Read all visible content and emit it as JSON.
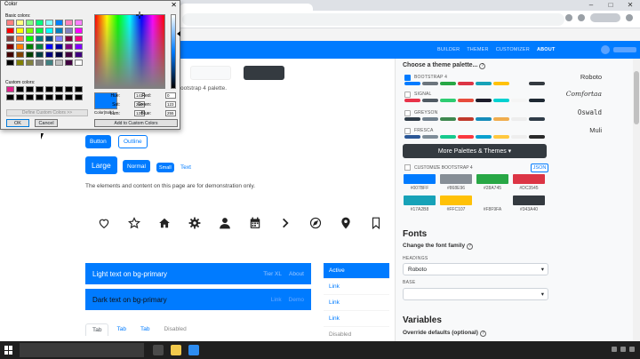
{
  "window_controls": [
    "–",
    "□",
    "✕"
  ],
  "navbar": {
    "links": [
      "BUILDER",
      "THEMER",
      "CUSTOMIZER",
      "ABOUT"
    ],
    "active": "ABOUT"
  },
  "page": {
    "palette_note": "ootstrap 4 palette.",
    "buttons": {
      "button": "Button",
      "outline": "Outline",
      "large": "Large",
      "normal": "Normal",
      "small": "Small",
      "text": "Text"
    },
    "demo_text": "The elements and content on this page are for demonstration only.",
    "icons": [
      "heart-icon",
      "star-icon",
      "home-icon",
      "gear-icon",
      "user-icon",
      "calendar-icon",
      "chevron-right-icon",
      "compass-icon",
      "map-pin-icon",
      "bookmark-icon"
    ],
    "alert_light": {
      "text": "Light text on bg-primary",
      "links": [
        "Tier XL",
        "About"
      ]
    },
    "alert_dark": {
      "text": "Dark text on bg-primary",
      "links": [
        "Link",
        "Demo"
      ]
    },
    "list_group": [
      "Active",
      "Link",
      "Link",
      "Link",
      "Disabled"
    ],
    "tabs": [
      "Tab",
      "Tab",
      "Tab",
      "Disabled"
    ]
  },
  "side": {
    "choose_title": "Choose a theme palette...",
    "themes": [
      {
        "name": "BOOTSTRAP 4",
        "checked": true,
        "font": "Roboto",
        "colors": [
          "#007bff",
          "#6c757d",
          "#28a745",
          "#dc3545",
          "#17a2b8",
          "#ffc107",
          "#f8f9fa",
          "#343a40"
        ]
      },
      {
        "name": "SIGNAL",
        "checked": false,
        "font": "Comfortaa",
        "colors": [
          "#e8334a",
          "#505a63",
          "#2ecc71",
          "#e74c3c",
          "#1c1c2b",
          "#00d1d1",
          "#f5f5f5",
          "#1f2933"
        ]
      },
      {
        "name": "GREYSON",
        "checked": false,
        "font": "Oswald",
        "colors": [
          "#2f3c48",
          "#6f7f8c",
          "#3e884f",
          "#c0392b",
          "#158cba",
          "#f0ad4e",
          "#ededed",
          "#2f3c48"
        ]
      },
      {
        "name": "FRESCA",
        "checked": false,
        "font": "Muli",
        "colors": [
          "#2b5797",
          "#7d8c98",
          "#16c98d",
          "#fa383e",
          "#0aa1cf",
          "#ffc83f",
          "#eeeeee",
          "#2a2a2a"
        ]
      }
    ],
    "more_button": "More Palettes & Themes",
    "customize_label": "CUSTOMIZE BOOTSTRAP 4",
    "json_button": "JSON",
    "swatches": [
      {
        "hex": "#007BFF",
        "color": "#007bff"
      },
      {
        "hex": "#868E96",
        "color": "#868e96"
      },
      {
        "hex": "#28A745",
        "color": "#28a745"
      },
      {
        "hex": "#DC3545",
        "color": "#dc3545"
      },
      {
        "hex": "#17A2B8",
        "color": "#17a2b8"
      },
      {
        "hex": "#FFC107",
        "color": "#ffc107"
      },
      {
        "hex": "#F8F9FA",
        "color": "#f8f9fa"
      },
      {
        "hex": "#343A40",
        "color": "#343a40"
      }
    ],
    "fonts_title": "Fonts",
    "fonts_sub": "Change the font family",
    "headings_label": "HEADINGS",
    "headings_value": "Roboto",
    "base_label": "BASE",
    "base_value": "",
    "variables_title": "Variables",
    "variables_sub": "Override defaults (optional)"
  },
  "dialog": {
    "title": "Color",
    "close": "✕",
    "basic_label": "Basic colors:",
    "basic_colors": [
      "#ff8080",
      "#ffff80",
      "#80ff80",
      "#00ff80",
      "#80ffff",
      "#0080ff",
      "#ff80c0",
      "#ff80ff",
      "#ff0000",
      "#ffff00",
      "#80ff00",
      "#00ff40",
      "#00ffff",
      "#0080c0",
      "#8080c0",
      "#ff00ff",
      "#804040",
      "#ff8040",
      "#00ff00",
      "#008080",
      "#004080",
      "#8080ff",
      "#800040",
      "#ff0080",
      "#800000",
      "#ff8000",
      "#008000",
      "#008040",
      "#0000ff",
      "#0000a0",
      "#800080",
      "#8000ff",
      "#400000",
      "#804000",
      "#004000",
      "#004040",
      "#000080",
      "#000040",
      "#400040",
      "#400080",
      "#000000",
      "#808000",
      "#808040",
      "#808080",
      "#408080",
      "#c0c0c0",
      "#400040",
      "#ffffff"
    ],
    "custom_label": "Custom colors:",
    "define_button": "Define Custom Colors >>",
    "ok": "OK",
    "cancel": "Cancel",
    "color_solid": "Color|Solid",
    "hue_label": "Hue:",
    "hue": "141",
    "sat_label": "Sat:",
    "sat": "240",
    "lum_label": "Lum:",
    "lum": "120",
    "red_label": "Red:",
    "red": "0",
    "green_label": "Green:",
    "green": "123",
    "blue_label": "Blue:",
    "blue": "255",
    "add_button": "Add to Custom Colors"
  }
}
